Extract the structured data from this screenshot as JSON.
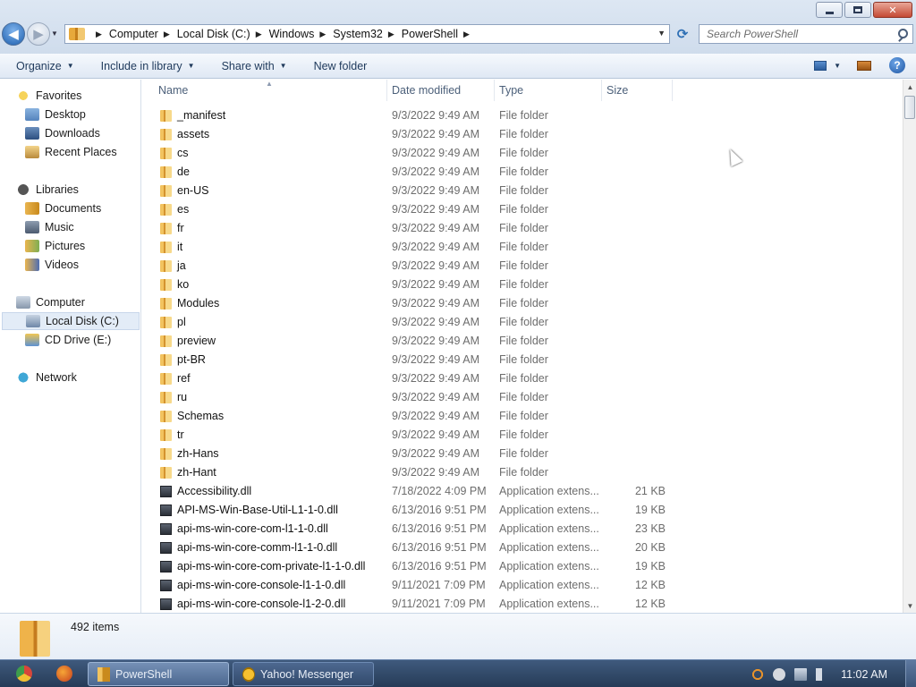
{
  "window": {
    "address": [
      "Computer",
      "Local Disk (C:)",
      "Windows",
      "System32",
      "PowerShell"
    ],
    "search_placeholder": "Search PowerShell"
  },
  "toolbar": {
    "organize": "Organize",
    "include_in_library": "Include in library",
    "share_with": "Share with",
    "new_folder": "New folder",
    "help": "?"
  },
  "navpane": {
    "favorites": "Favorites",
    "desktop": "Desktop",
    "downloads": "Downloads",
    "recent_places": "Recent Places",
    "libraries": "Libraries",
    "documents": "Documents",
    "music": "Music",
    "pictures": "Pictures",
    "videos": "Videos",
    "computer": "Computer",
    "local_disk": "Local Disk (C:)",
    "cd_drive": "CD Drive (E:)",
    "network": "Network"
  },
  "columns": {
    "name": "Name",
    "date_modified": "Date modified",
    "type": "Type",
    "size": "Size"
  },
  "files": [
    {
      "name": "_manifest",
      "date": "9/3/2022 9:49 AM",
      "type": "File folder",
      "size": "",
      "kind": "folder"
    },
    {
      "name": "assets",
      "date": "9/3/2022 9:49 AM",
      "type": "File folder",
      "size": "",
      "kind": "folder"
    },
    {
      "name": "cs",
      "date": "9/3/2022 9:49 AM",
      "type": "File folder",
      "size": "",
      "kind": "folder"
    },
    {
      "name": "de",
      "date": "9/3/2022 9:49 AM",
      "type": "File folder",
      "size": "",
      "kind": "folder"
    },
    {
      "name": "en-US",
      "date": "9/3/2022 9:49 AM",
      "type": "File folder",
      "size": "",
      "kind": "folder"
    },
    {
      "name": "es",
      "date": "9/3/2022 9:49 AM",
      "type": "File folder",
      "size": "",
      "kind": "folder"
    },
    {
      "name": "fr",
      "date": "9/3/2022 9:49 AM",
      "type": "File folder",
      "size": "",
      "kind": "folder"
    },
    {
      "name": "it",
      "date": "9/3/2022 9:49 AM",
      "type": "File folder",
      "size": "",
      "kind": "folder"
    },
    {
      "name": "ja",
      "date": "9/3/2022 9:49 AM",
      "type": "File folder",
      "size": "",
      "kind": "folder"
    },
    {
      "name": "ko",
      "date": "9/3/2022 9:49 AM",
      "type": "File folder",
      "size": "",
      "kind": "folder"
    },
    {
      "name": "Modules",
      "date": "9/3/2022 9:49 AM",
      "type": "File folder",
      "size": "",
      "kind": "folder"
    },
    {
      "name": "pl",
      "date": "9/3/2022 9:49 AM",
      "type": "File folder",
      "size": "",
      "kind": "folder"
    },
    {
      "name": "preview",
      "date": "9/3/2022 9:49 AM",
      "type": "File folder",
      "size": "",
      "kind": "folder"
    },
    {
      "name": "pt-BR",
      "date": "9/3/2022 9:49 AM",
      "type": "File folder",
      "size": "",
      "kind": "folder"
    },
    {
      "name": "ref",
      "date": "9/3/2022 9:49 AM",
      "type": "File folder",
      "size": "",
      "kind": "folder"
    },
    {
      "name": "ru",
      "date": "9/3/2022 9:49 AM",
      "type": "File folder",
      "size": "",
      "kind": "folder"
    },
    {
      "name": "Schemas",
      "date": "9/3/2022 9:49 AM",
      "type": "File folder",
      "size": "",
      "kind": "folder"
    },
    {
      "name": "tr",
      "date": "9/3/2022 9:49 AM",
      "type": "File folder",
      "size": "",
      "kind": "folder"
    },
    {
      "name": "zh-Hans",
      "date": "9/3/2022 9:49 AM",
      "type": "File folder",
      "size": "",
      "kind": "folder"
    },
    {
      "name": "zh-Hant",
      "date": "9/3/2022 9:49 AM",
      "type": "File folder",
      "size": "",
      "kind": "folder"
    },
    {
      "name": "Accessibility.dll",
      "date": "7/18/2022 4:09 PM",
      "type": "Application extens...",
      "size": "21 KB",
      "kind": "dll"
    },
    {
      "name": "API-MS-Win-Base-Util-L1-1-0.dll",
      "date": "6/13/2016 9:51 PM",
      "type": "Application extens...",
      "size": "19 KB",
      "kind": "dll"
    },
    {
      "name": "api-ms-win-core-com-l1-1-0.dll",
      "date": "6/13/2016 9:51 PM",
      "type": "Application extens...",
      "size": "23 KB",
      "kind": "dll"
    },
    {
      "name": "api-ms-win-core-comm-l1-1-0.dll",
      "date": "6/13/2016 9:51 PM",
      "type": "Application extens...",
      "size": "20 KB",
      "kind": "dll"
    },
    {
      "name": "api-ms-win-core-com-private-l1-1-0.dll",
      "date": "6/13/2016 9:51 PM",
      "type": "Application extens...",
      "size": "19 KB",
      "kind": "dll"
    },
    {
      "name": "api-ms-win-core-console-l1-1-0.dll",
      "date": "9/11/2021 7:09 PM",
      "type": "Application extens...",
      "size": "12 KB",
      "kind": "dll"
    },
    {
      "name": "api-ms-win-core-console-l1-2-0.dll",
      "date": "9/11/2021 7:09 PM",
      "type": "Application extens...",
      "size": "12 KB",
      "kind": "dll"
    }
  ],
  "details": {
    "item_count": "492 items"
  },
  "taskbar": {
    "tasks": [
      "PowerShell",
      "Yahoo! Messenger"
    ],
    "clock": "11:02 AM"
  }
}
